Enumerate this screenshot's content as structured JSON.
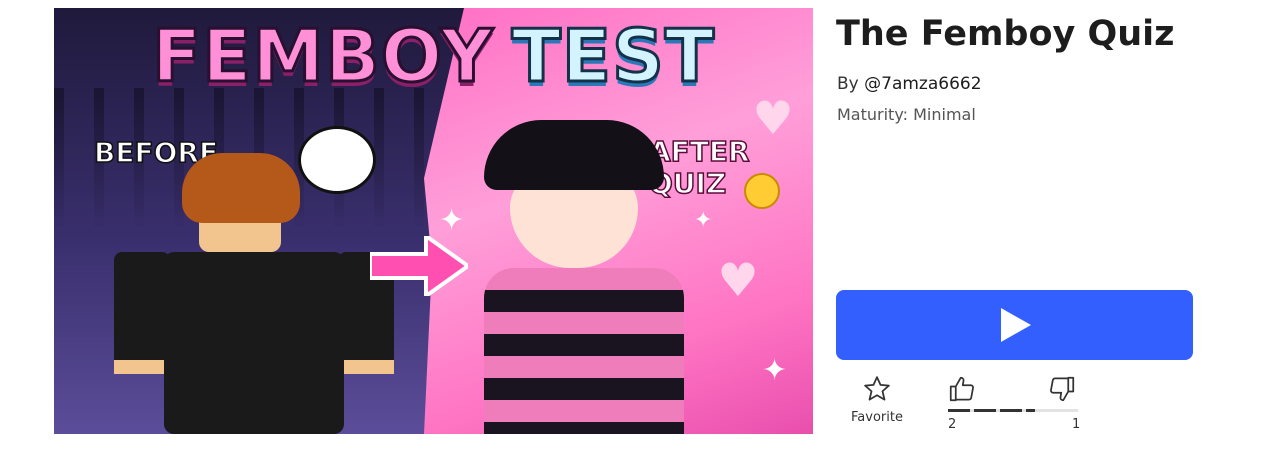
{
  "thumbnail": {
    "title_word1": "FEMBOY",
    "title_word2": "TEST",
    "label_before": "BEFORE",
    "label_after_line1": "AFTER",
    "label_after_line2": "QUIZ"
  },
  "game": {
    "title": "The Femboy Quiz",
    "by_label": "By",
    "creator": "@7amza6662",
    "maturity": "Maturity: Minimal"
  },
  "actions": {
    "play_icon": "play-icon",
    "favorite_label": "Favorite",
    "like_count": "2",
    "dislike_count": "1",
    "like_ratio": 0.67
  },
  "colors": {
    "play_button": "#335fff",
    "title_text": "#1d1d1d"
  }
}
